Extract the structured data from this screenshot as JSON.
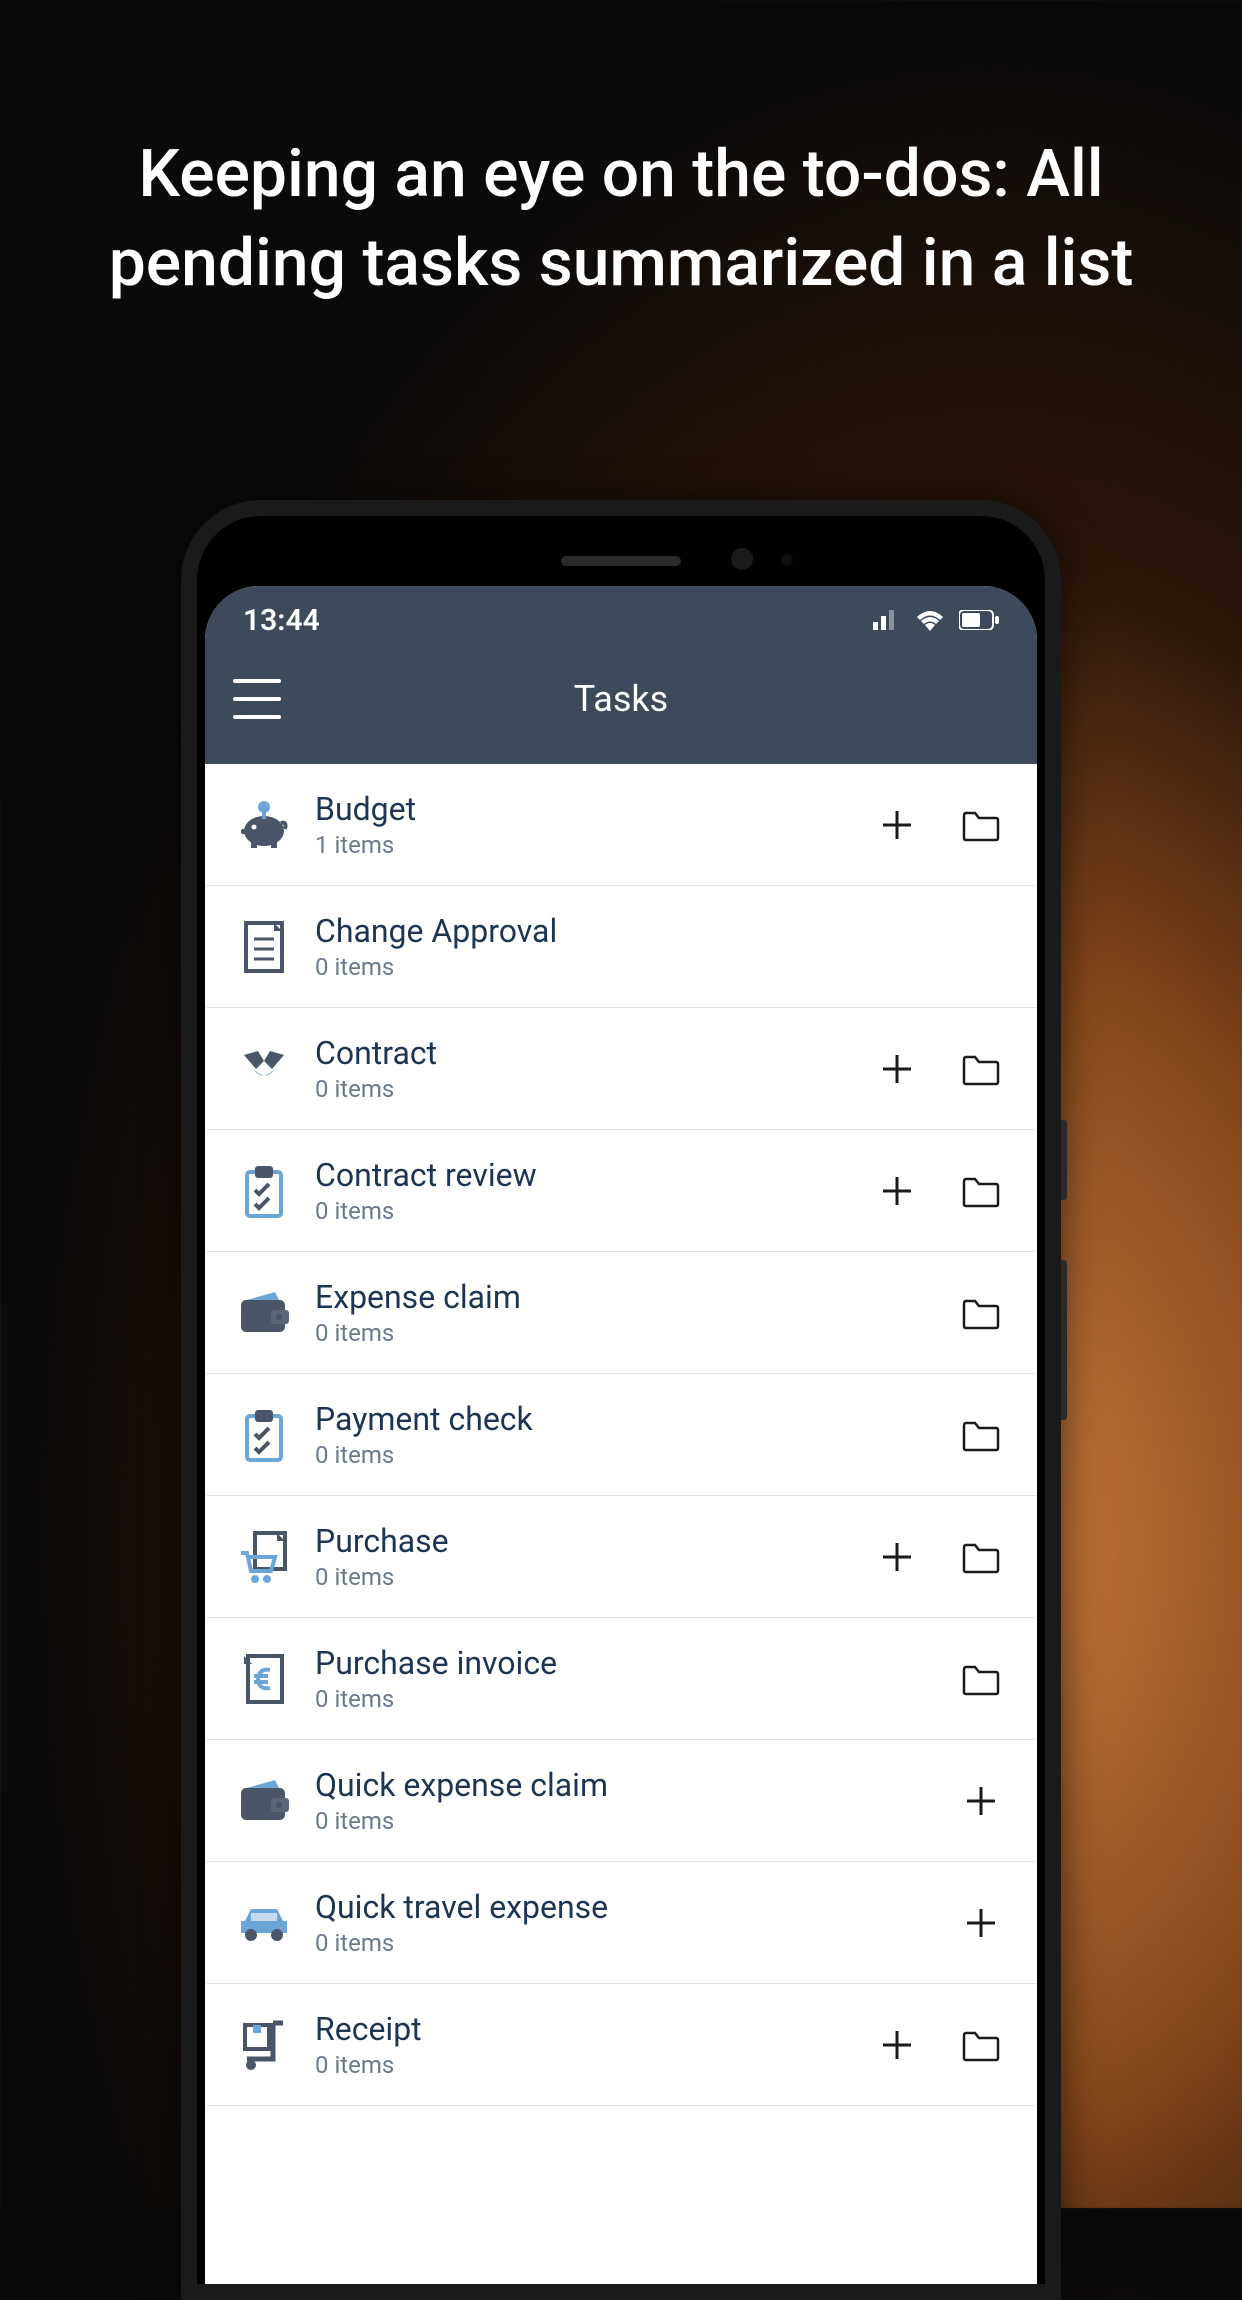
{
  "headline": "Keeping an eye on the to-dos: All pending tasks summarized in a list",
  "statusbar": {
    "time": "13:44"
  },
  "navbar": {
    "title": "Tasks"
  },
  "tasks": [
    {
      "title": "Budget",
      "count": "1 items",
      "icon": "piggy",
      "add": true,
      "folder": true
    },
    {
      "title": "Change Approval",
      "count": "0 items",
      "icon": "document",
      "add": false,
      "folder": false
    },
    {
      "title": "Contract",
      "count": "0 items",
      "icon": "handshake",
      "add": true,
      "folder": true
    },
    {
      "title": "Contract review",
      "count": "0 items",
      "icon": "clipboard",
      "add": true,
      "folder": true
    },
    {
      "title": "Expense claim",
      "count": "0 items",
      "icon": "wallet",
      "add": false,
      "folder": true
    },
    {
      "title": "Payment check",
      "count": "0 items",
      "icon": "clipboard",
      "add": false,
      "folder": true
    },
    {
      "title": "Purchase",
      "count": "0 items",
      "icon": "cart",
      "add": true,
      "folder": true
    },
    {
      "title": "Purchase invoice",
      "count": "0 items",
      "icon": "euro",
      "add": false,
      "folder": true
    },
    {
      "title": "Quick expense claim",
      "count": "0 items",
      "icon": "wallet",
      "add": false,
      "folder": false,
      "addonly": true
    },
    {
      "title": "Quick travel expense",
      "count": "0 items",
      "icon": "car",
      "add": false,
      "folder": false,
      "addonly": true
    },
    {
      "title": "Receipt",
      "count": "0 items",
      "icon": "dolly",
      "add": true,
      "folder": true
    }
  ]
}
